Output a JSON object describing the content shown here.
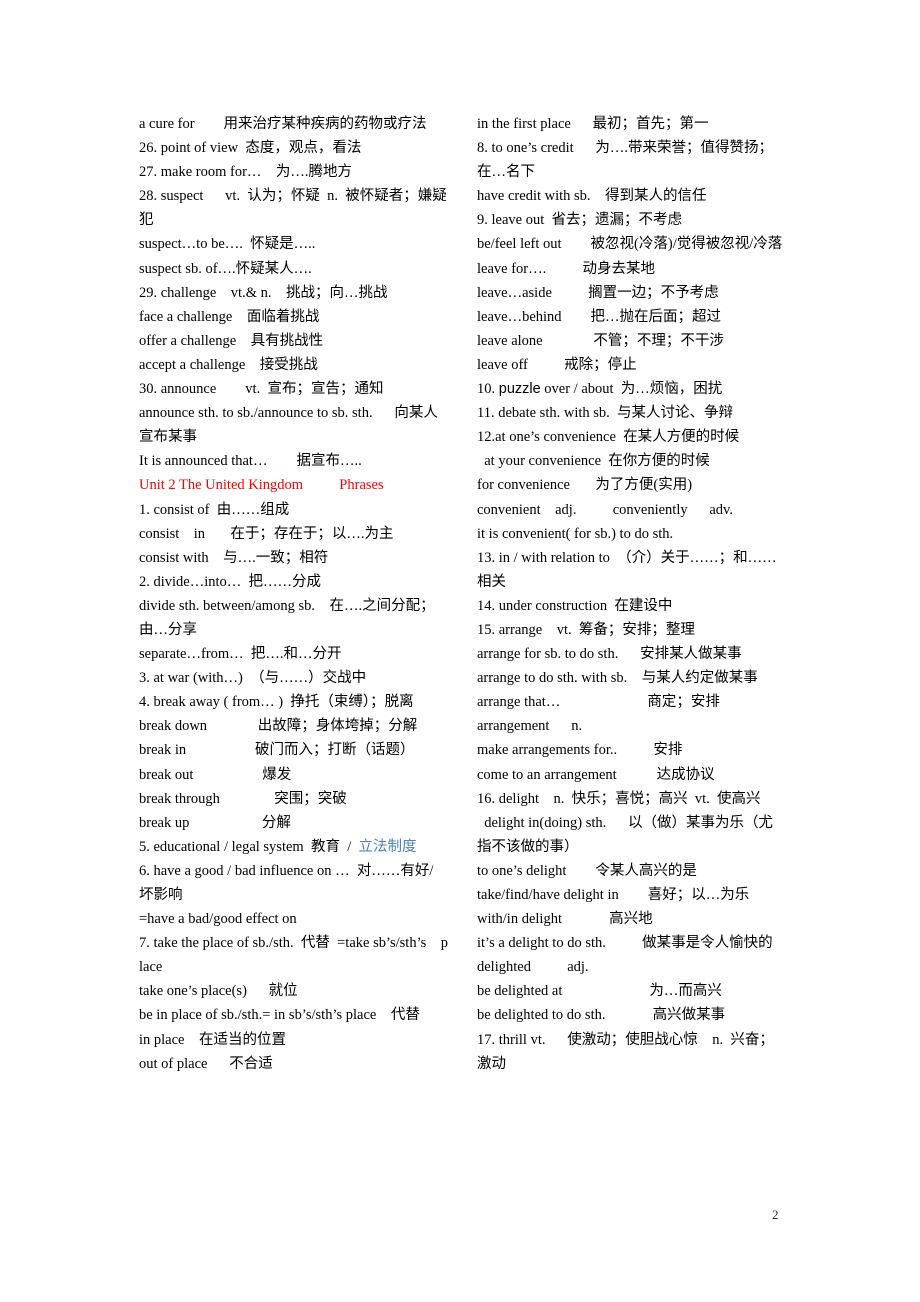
{
  "document": {
    "page_number": "2",
    "left_column": [
      {
        "text": "a cure for        用来治疗某种疾病的药物或疗法"
      },
      {
        "text": "26. point of view  态度，观点，看法"
      },
      {
        "text": "27. make room for…    为….腾地方"
      },
      {
        "text": "28. suspect      vt.  认为；怀疑  n.  被怀疑者；嫌疑犯"
      },
      {
        "text": "suspect…to be….  怀疑是….."
      },
      {
        "text": "suspect sb. of….怀疑某人…."
      },
      {
        "text": "29. challenge    vt.& n.    挑战；向…挑战"
      },
      {
        "text": "face a challenge    面临着挑战"
      },
      {
        "text": "offer a challenge    具有挑战性"
      },
      {
        "text": "accept a challenge    接受挑战"
      },
      {
        "text": "30. announce        vt.  宣布；宣告；通知"
      },
      {
        "text": "announce sth. to sb./announce to sb. sth.      向某人宣布某事"
      },
      {
        "text": "It is announced that…        据宣布….."
      },
      {
        "text": "Unit 2 The United Kingdom          Phrases",
        "style": "heading-red"
      },
      {
        "text": "1. consist of  由……组成"
      },
      {
        "text": "consist    in       在于；存在于；以….为主"
      },
      {
        "text": "consist with    与….一致；相符"
      },
      {
        "text": "2. divide…into…  把……分成"
      },
      {
        "text": "divide sth. between/among sb.    在….之间分配；由…分享"
      },
      {
        "text": "separate…from…  把….和…分开"
      },
      {
        "text": "3. at war (with…)  （与……）交战中"
      },
      {
        "text": "4. break away ( from… )  挣托（束缚）；脱离"
      },
      {
        "text": "break down              出故障；身体垮掉；分解"
      },
      {
        "text": "break in                   破门而入；打断（话题）"
      },
      {
        "text": "break out                   爆发"
      },
      {
        "text": "break through               突围；突破"
      },
      {
        "text": "break up                    分解"
      },
      {
        "text": "5. educational / legal system  教育  /  ",
        "highlight": "立法制度"
      },
      {
        "text": "6. have a good / bad influence on …  对……有好/  坏影响"
      },
      {
        "text": "=have a bad/good effect on"
      },
      {
        "text": "7. take the place of sb./sth.  代替  =take sb’s/sth’s    place"
      },
      {
        "text": "take one’s place(s)      就位"
      },
      {
        "text": "be in place of sb./sth.= in sb’s/sth’s place    代替"
      },
      {
        "text": "in place    在适当的位置"
      },
      {
        "text": "out of place      不合适"
      }
    ],
    "right_column": [
      {
        "text": "in the first place      最初；首先；第一"
      },
      {
        "text": "8. to one’s credit      为….带来荣誉；值得赞扬；在…名下"
      },
      {
        "text": "have credit with sb.    得到某人的信任"
      },
      {
        "text": "9. leave out  省去；遗漏；不考虑"
      },
      {
        "text": "be/feel left out        被忽视(冷落)/觉得被忽视/冷落"
      },
      {
        "text": "leave for….          动身去某地"
      },
      {
        "text": "leave…aside          搁置一边；不予考虑"
      },
      {
        "text": "leave…behind        把…抛在后面；超过"
      },
      {
        "text": "leave alone              不管；不理；不干涉"
      },
      {
        "text": "leave off          戒除；停止"
      },
      {
        "text": "10. ",
        "sans_word": "puzzle",
        "rest": " over / about  为…烦恼，困扰"
      },
      {
        "text": "11. debate sth. with sb.  与某人讨论、争辩"
      },
      {
        "text": "12.at one’s convenience  在某人方便的时候"
      },
      {
        "text": "  at your convenience  在你方便的时候"
      },
      {
        "text": "for convenience       为了方便(实用)"
      },
      {
        "text": "convenient    adj.          conveniently      adv."
      },
      {
        "text": "it is convenient( for sb.) to do sth."
      },
      {
        "text": "13. in / with relation to  （介）关于……；和……相关"
      },
      {
        "text": "14. under construction  在建设中"
      },
      {
        "text": "15. arrange    vt.  筹备；安排；整理"
      },
      {
        "text": "arrange for sb. to do sth.      安排某人做某事"
      },
      {
        "text": "arrange to do sth. with sb.    与某人约定做某事"
      },
      {
        "text": "arrange that…                        商定；安排"
      },
      {
        "text": "arrangement      n."
      },
      {
        "text": "make arrangements for..          安排"
      },
      {
        "text": "come to an arrangement           达成协议"
      },
      {
        "text": "16. delight    n.  快乐；喜悦；高兴  vt.  使高兴"
      },
      {
        "text": "  delight in(doing) sth.      以（做）某事为乐（尤指不该做的事）"
      },
      {
        "text": "to one’s delight        令某人高兴的是"
      },
      {
        "text": "take/find/have delight in        喜好；以…为乐"
      },
      {
        "text": "with/in delight             高兴地"
      },
      {
        "text": "it’s a delight to do sth.          做某事是令人愉快的"
      },
      {
        "text": "delighted          adj."
      },
      {
        "text": "be delighted at                        为…而高兴"
      },
      {
        "text": "be delighted to do sth.             高兴做某事"
      },
      {
        "text": "17. thrill vt.      使激动；使胆战心惊    n.  兴奋；激动"
      }
    ],
    "colors": {
      "heading": "#ff0000",
      "highlight": "#4f81bd",
      "text": "#000000"
    }
  }
}
